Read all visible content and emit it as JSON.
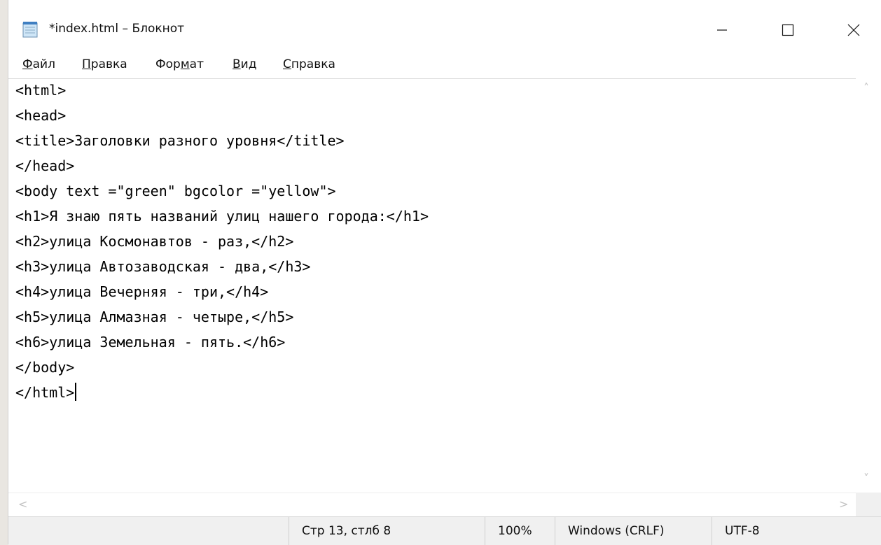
{
  "window": {
    "title": "*index.html – Блокнот",
    "icon": "notepad-icon",
    "controls": {
      "minimize": "minimize-icon",
      "maximize": "maximize-icon",
      "close": "close-icon"
    }
  },
  "menu": {
    "items": [
      {
        "pre": "",
        "key": "Ф",
        "post": "айл"
      },
      {
        "pre": "",
        "key": "П",
        "post": "равка"
      },
      {
        "pre": "Фор",
        "key": "м",
        "post": "ат"
      },
      {
        "pre": "",
        "key": "В",
        "post": "ид"
      },
      {
        "pre": "",
        "key": "С",
        "post": "правка"
      }
    ]
  },
  "editor": {
    "lines": [
      "<html>",
      "<head>",
      "<title>Заголовки разного уровня</title>",
      "</head>",
      "<body text =\"green\" bgcolor =\"yellow\">",
      "<h1>Я знаю пять названий улиц нашего города:</h1>",
      "<h2>улица Космонавтов - раз,</h2>",
      "<h3>улица Автозаводская - два,</h3>",
      "<h4>улица Вечерняя - три,</h4>",
      "<h5>улица Алмазная - четыре,</h5>",
      "<h6>улица Земельная - пять.</h6>",
      "</body>",
      "</html>"
    ]
  },
  "status": {
    "position": "Стр 13, стлб 8",
    "zoom": "100%",
    "line_ending": "Windows (CRLF)",
    "encoding": "UTF-8"
  }
}
